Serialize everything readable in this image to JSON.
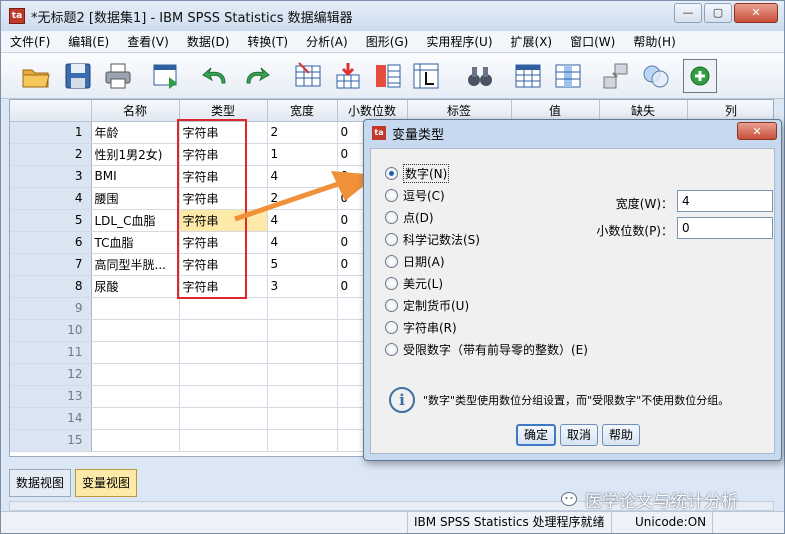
{
  "window": {
    "title": "*无标题2 [数据集1] - IBM SPSS Statistics 数据编辑器",
    "icon_text": "ta",
    "minimize": "—",
    "maximize": "▢",
    "close": "✕"
  },
  "menu": [
    "文件(F)",
    "编辑(E)",
    "查看(V)",
    "数据(D)",
    "转换(T)",
    "分析(A)",
    "图形(G)",
    "实用程序(U)",
    "扩展(X)",
    "窗口(W)",
    "帮助(H)"
  ],
  "grid": {
    "columns": [
      "",
      "名称",
      "类型",
      "宽度",
      "小数位数",
      "标签",
      "值",
      "缺失",
      "列"
    ],
    "rows": [
      {
        "num": "1",
        "name": "年龄",
        "type": "字符串",
        "width": "2",
        "decimals": "0"
      },
      {
        "num": "2",
        "name": "性别1男2女)",
        "type": "字符串",
        "width": "1",
        "decimals": "0"
      },
      {
        "num": "3",
        "name": "BMI",
        "type": "字符串",
        "width": "4",
        "decimals": "0"
      },
      {
        "num": "4",
        "name": "腰围",
        "type": "字符串",
        "width": "2",
        "decimals": "0"
      },
      {
        "num": "5",
        "name": "LDL_C血脂",
        "type": "字符串",
        "width": "4",
        "decimals": "0"
      },
      {
        "num": "6",
        "name": "TC血脂",
        "type": "字符串",
        "width": "4",
        "decimals": "0"
      },
      {
        "num": "7",
        "name": "高同型半胱...",
        "type": "字符串",
        "width": "5",
        "decimals": "0"
      },
      {
        "num": "8",
        "name": "尿酸",
        "type": "字符串",
        "width": "3",
        "decimals": "0"
      }
    ],
    "empty_rows": [
      "9",
      "10",
      "11",
      "12",
      "13",
      "14",
      "15"
    ]
  },
  "tabs": {
    "data_view": "数据视图",
    "variable_view": "变量视图"
  },
  "status": {
    "processor": "IBM SPSS Statistics 处理程序就绪",
    "unicode": "Unicode:ON"
  },
  "watermark": "医学论文与统计分析",
  "dialog": {
    "title": "变量类型",
    "close": "✕",
    "options": [
      "数字(N)",
      "逗号(C)",
      "点(D)",
      "科学记数法(S)",
      "日期(A)",
      "美元(L)",
      "定制货币(U)",
      "字符串(R)",
      "受限数字（带有前导零的整数）(E)"
    ],
    "selected_index": 0,
    "width_label": "宽度(W)：",
    "width_value": "4",
    "decimals_label": "小数位数(P)：",
    "decimals_value": "0",
    "info_icon": "i",
    "info_text": "\"数字\"类型使用数位分组设置，而\"受限数字\"不使用数位分组。",
    "ok": "确定",
    "cancel": "取消",
    "help": "帮助"
  },
  "colors": {
    "highlight_red": "#e0262b",
    "arrow_orange": "#f0913a",
    "selected_cell": "#fde9a8",
    "accent_blue": "#1f5fb3"
  }
}
